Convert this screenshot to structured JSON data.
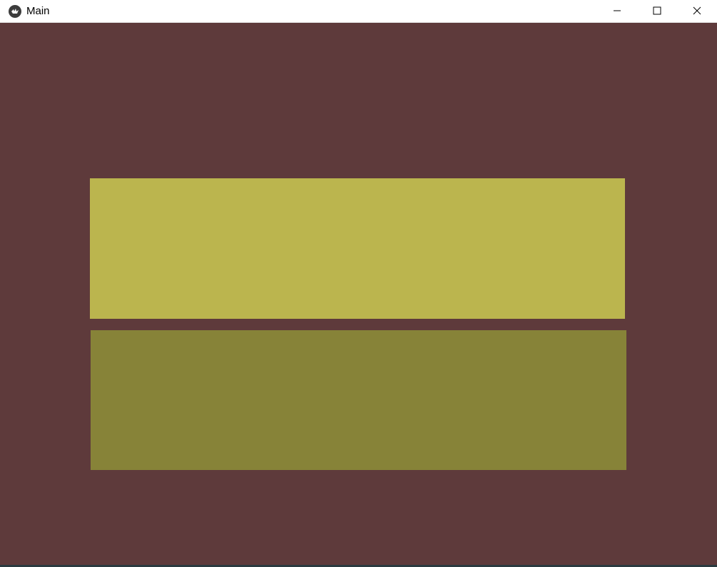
{
  "window": {
    "title": "Main",
    "icon": "kivy-logo-icon",
    "controls": {
      "minimize_icon": "minimize-icon",
      "maximize_icon": "maximize-icon",
      "close_icon": "close-icon"
    }
  },
  "content": {
    "header_text": "",
    "top_button": {
      "label": "",
      "color": "#bbb54e"
    },
    "bottom_button": {
      "label": "",
      "color": "#878338"
    },
    "background_color": "#5e3a3b"
  }
}
